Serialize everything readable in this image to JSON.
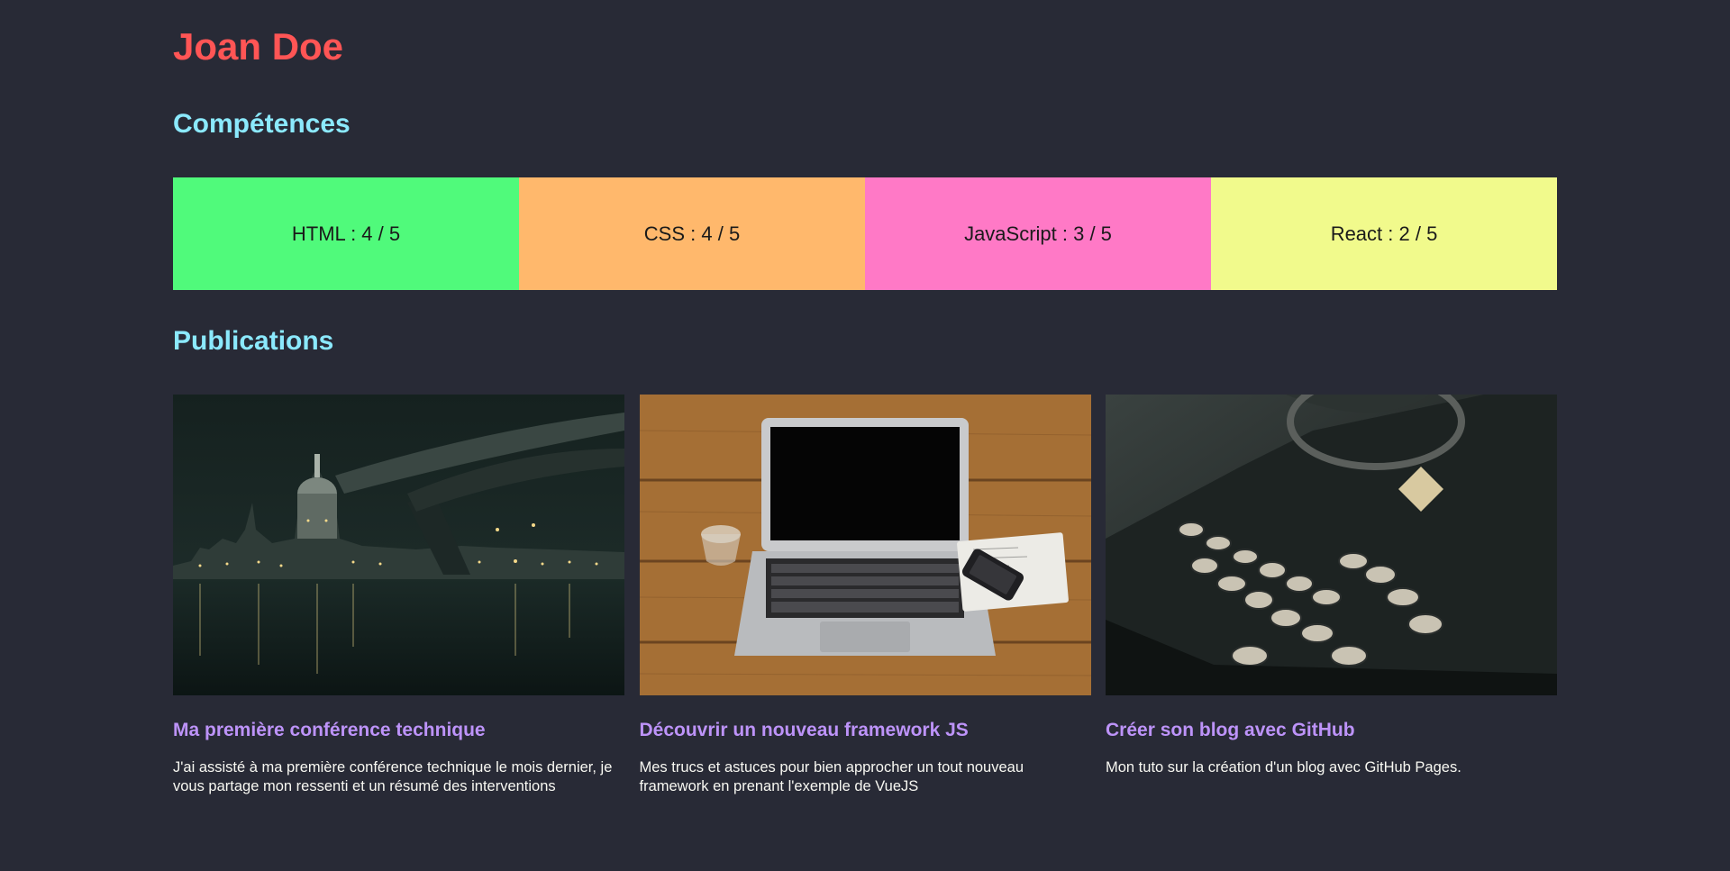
{
  "header": {
    "name": "Joan Doe"
  },
  "skills_section": {
    "title": "Compétences",
    "items": [
      {
        "label": "HTML : 4 / 5",
        "color": "#50fa7b"
      },
      {
        "label": "CSS : 4 / 5",
        "color": "#ffb86c"
      },
      {
        "label": "JavaScript : 3 / 5",
        "color": "#ff79c6"
      },
      {
        "label": "React : 2 / 5",
        "color": "#f1fa8c"
      }
    ]
  },
  "publications_section": {
    "title": "Publications",
    "items": [
      {
        "title": "Ma première conférence technique",
        "text": "J'ai assisté à ma première conférence technique le mois dernier, je vous partage mon ressenti et un résumé des interventions",
        "image": "night-city-bridge-photo"
      },
      {
        "title": "Découvrir un nouveau framework JS",
        "text": "Mes trucs et astuces pour bien approcher un tout nouveau framework en prenant l'exemple de VueJS",
        "image": "laptop-on-wooden-desk-photo"
      },
      {
        "title": "Créer son blog avec GitHub",
        "text": "Mon tuto sur la création d'un blog avec GitHub Pages.",
        "image": "vintage-typewriter-photo"
      }
    ]
  },
  "colors": {
    "background": "#282a36",
    "name": "#ff5555",
    "section_title": "#8be9fd",
    "card_title": "#bd93f9",
    "card_text": "#f8f8f2"
  }
}
